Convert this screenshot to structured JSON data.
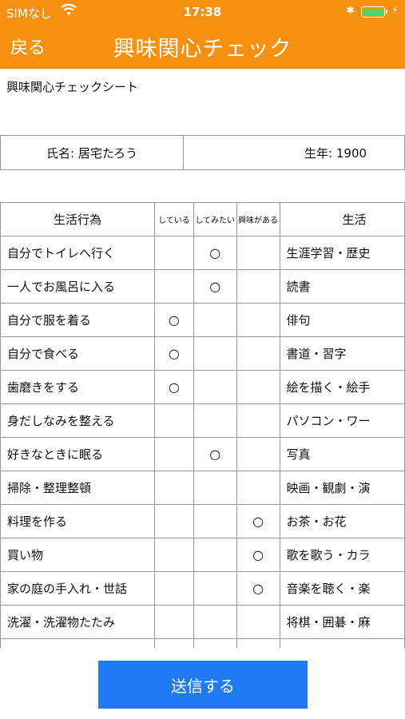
{
  "status_bar": {
    "carrier": "SIMなし",
    "time": "17:38",
    "battery_color": "#4cd964"
  },
  "nav": {
    "back_label": "戻る",
    "title": "興味関心チェック",
    "background": "#f7900e"
  },
  "sheet_title": "興味関心チェックシート",
  "info": {
    "name_label": "氏名: 居宅たろう",
    "birth_label": "生年: 1900"
  },
  "table": {
    "headers": {
      "activity": "生活行為",
      "doing": "している",
      "want_to": "してみたい",
      "interested": "興味がある",
      "activity2": "生活"
    },
    "rows": [
      {
        "activity": "自分でトイレへ行く",
        "doing": "",
        "want_to": "○",
        "interested": "",
        "activity2": "生涯学習・歴史"
      },
      {
        "activity": "一人でお風呂に入る",
        "doing": "",
        "want_to": "○",
        "interested": "",
        "activity2": "読書"
      },
      {
        "activity": "自分で服を着る",
        "doing": "○",
        "want_to": "",
        "interested": "",
        "activity2": "俳句"
      },
      {
        "activity": "自分で食べる",
        "doing": "○",
        "want_to": "",
        "interested": "",
        "activity2": "書道・習字"
      },
      {
        "activity": "歯磨きをする",
        "doing": "○",
        "want_to": "",
        "interested": "",
        "activity2": "絵を描く・絵手"
      },
      {
        "activity": "身だしなみを整える",
        "doing": "",
        "want_to": "",
        "interested": "",
        "activity2": "パソコン・ワー"
      },
      {
        "activity": "好きなときに眠る",
        "doing": "",
        "want_to": "○",
        "interested": "",
        "activity2": "写真"
      },
      {
        "activity": "掃除・整理整頓",
        "doing": "",
        "want_to": "",
        "interested": "",
        "activity2": "映画・観劇・演"
      },
      {
        "activity": "料理を作る",
        "doing": "",
        "want_to": "",
        "interested": "○",
        "activity2": "お茶・お花"
      },
      {
        "activity": "買い物",
        "doing": "",
        "want_to": "",
        "interested": "○",
        "activity2": "歌を歌う・カラ"
      },
      {
        "activity": "家の庭の手入れ・世話",
        "doing": "",
        "want_to": "",
        "interested": "○",
        "activity2": "音楽を聴く・楽"
      },
      {
        "activity": "洗濯・洗濯物たたみ",
        "doing": "",
        "want_to": "",
        "interested": "",
        "activity2": "将棋・囲碁・麻"
      },
      {
        "activity": "",
        "doing": "",
        "want_to": "",
        "interested": "",
        "activity2": ""
      }
    ]
  },
  "submit_label": "送信する",
  "submit_color": "#1e7bf5"
}
